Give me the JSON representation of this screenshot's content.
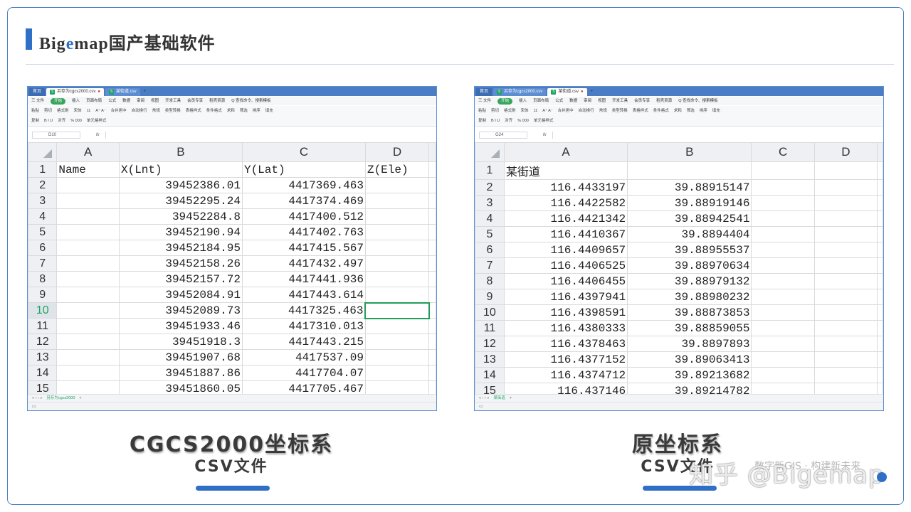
{
  "slide": {
    "title_prefix": "Bigemap",
    "title_suffix": "国产基础软件"
  },
  "left_window": {
    "tabs": [
      "首页",
      "另存为cgcs2000.csv",
      "某街道.csv"
    ],
    "name_box": "D10",
    "sheet_tab": "另存为cgcs2000",
    "columns": [
      "A",
      "B",
      "C",
      "D"
    ],
    "selected_column": "D",
    "selected_row": "10",
    "rows": [
      {
        "n": "1",
        "a": "Name",
        "b": "X(Lnt)",
        "c": "Y(Lat)",
        "d": "Z(Ele)"
      },
      {
        "n": "2",
        "a": "",
        "b": "39452386.01",
        "c": "4417369.463",
        "d": ""
      },
      {
        "n": "3",
        "a": "",
        "b": "39452295.24",
        "c": "4417374.469",
        "d": ""
      },
      {
        "n": "4",
        "a": "",
        "b": "39452284.8",
        "c": "4417400.512",
        "d": ""
      },
      {
        "n": "5",
        "a": "",
        "b": "39452190.94",
        "c": "4417402.763",
        "d": ""
      },
      {
        "n": "6",
        "a": "",
        "b": "39452184.95",
        "c": "4417415.567",
        "d": ""
      },
      {
        "n": "7",
        "a": "",
        "b": "39452158.26",
        "c": "4417432.497",
        "d": ""
      },
      {
        "n": "8",
        "a": "",
        "b": "39452157.72",
        "c": "4417441.936",
        "d": ""
      },
      {
        "n": "9",
        "a": "",
        "b": "39452084.91",
        "c": "4417443.614",
        "d": ""
      },
      {
        "n": "10",
        "a": "",
        "b": "39452089.73",
        "c": "4417325.463",
        "d": ""
      },
      {
        "n": "11",
        "a": "",
        "b": "39451933.46",
        "c": "4417310.013",
        "d": ""
      },
      {
        "n": "12",
        "a": "",
        "b": "39451918.3",
        "c": "4417443.215",
        "d": ""
      },
      {
        "n": "13",
        "a": "",
        "b": "39451907.68",
        "c": "4417537.09",
        "d": ""
      },
      {
        "n": "14",
        "a": "",
        "b": "39451887.86",
        "c": "4417704.07",
        "d": ""
      },
      {
        "n": "15",
        "a": "",
        "b": "39451860.05",
        "c": "4417705.467",
        "d": ""
      }
    ]
  },
  "right_window": {
    "tabs": [
      "首页",
      "另存为cgcs2000.csv",
      "某街道.csv"
    ],
    "name_box": "G24",
    "sheet_tab": "某街道",
    "columns": [
      "A",
      "B",
      "C",
      "D"
    ],
    "rows": [
      {
        "n": "1",
        "a": "某街道",
        "b": "",
        "c": "",
        "d": ""
      },
      {
        "n": "2",
        "a": "116.4433197",
        "b": "39.88915147",
        "c": "",
        "d": ""
      },
      {
        "n": "3",
        "a": "116.4422582",
        "b": "39.88919146",
        "c": "",
        "d": ""
      },
      {
        "n": "4",
        "a": "116.4421342",
        "b": "39.88942541",
        "c": "",
        "d": ""
      },
      {
        "n": "5",
        "a": "116.4410367",
        "b": "39.8894404",
        "c": "",
        "d": ""
      },
      {
        "n": "6",
        "a": "116.4409657",
        "b": "39.88955537",
        "c": "",
        "d": ""
      },
      {
        "n": "7",
        "a": "116.4406525",
        "b": "39.88970634",
        "c": "",
        "d": ""
      },
      {
        "n": "8",
        "a": "116.4406455",
        "b": "39.88979132",
        "c": "",
        "d": ""
      },
      {
        "n": "9",
        "a": "116.4397941",
        "b": "39.88980232",
        "c": "",
        "d": ""
      },
      {
        "n": "10",
        "a": "116.4398591",
        "b": "39.88873853",
        "c": "",
        "d": ""
      },
      {
        "n": "11",
        "a": "116.4380333",
        "b": "39.88859055",
        "c": "",
        "d": ""
      },
      {
        "n": "12",
        "a": "116.4378463",
        "b": "39.8897893",
        "c": "",
        "d": ""
      },
      {
        "n": "13",
        "a": "116.4377152",
        "b": "39.89063413",
        "c": "",
        "d": ""
      },
      {
        "n": "14",
        "a": "116.4374712",
        "b": "39.89213682",
        "c": "",
        "d": ""
      },
      {
        "n": "15",
        "a": "116.437146",
        "b": "39.89214782",
        "c": "",
        "d": ""
      }
    ]
  },
  "toolbar": {
    "menu": [
      "三 文件",
      "开始",
      "插入",
      "页面布局",
      "公式",
      "数据",
      "审阅",
      "视图",
      "开发工具",
      "会员专享",
      "稻壳资源",
      "Q 查找命令、搜索模板"
    ],
    "ribbon_row1": [
      "粘贴",
      "剪切",
      "格式刷",
      "宋体",
      "11",
      "A⁺ A⁻",
      "合并居中",
      "自动换行",
      "常规",
      "类型转换",
      "表格样式",
      "条件格式",
      "求和",
      "筛选",
      "排序",
      "填充"
    ],
    "ribbon_row2": [
      "复制",
      "B I U",
      "对齐",
      "% 000",
      "单元格样式"
    ]
  },
  "captions": {
    "left_main": "CGCS2000坐标系",
    "left_sub": "CSV文件",
    "right_main": "原坐标系",
    "right_sub": "CSV文件"
  },
  "watermark": {
    "text": "知乎 @Bigemap",
    "small": "数字新GIS · 构建新未来"
  },
  "colors": {
    "accent": "#2f6fc5",
    "spreadsheet_green": "#1fa463",
    "tab_bar": "#4b7dc4"
  }
}
